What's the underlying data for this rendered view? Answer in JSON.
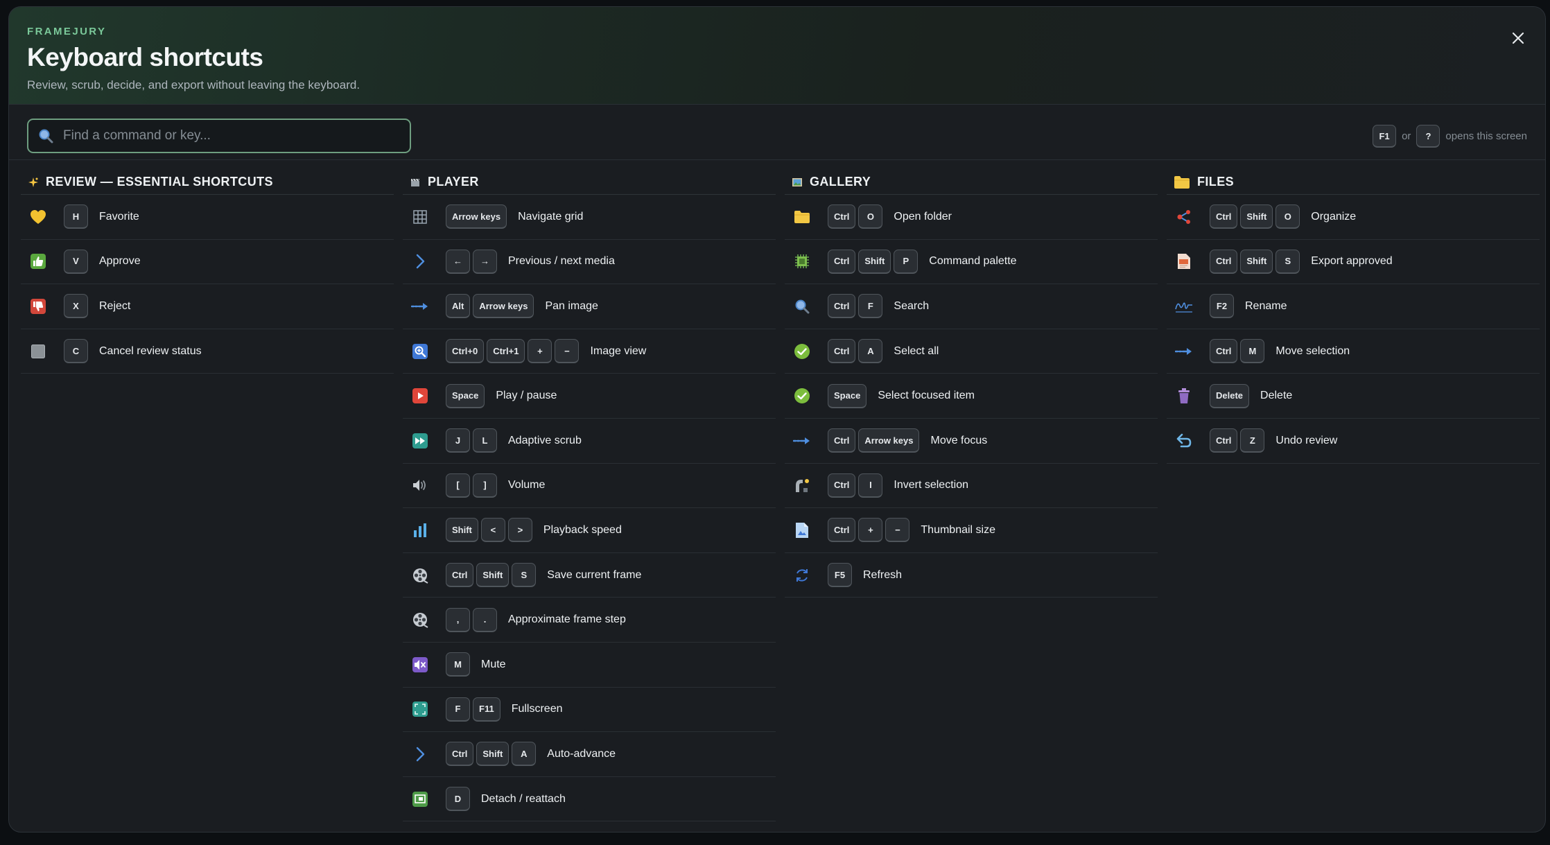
{
  "header": {
    "brand": "FRAMEJURY",
    "title": "Keyboard shortcuts",
    "subtitle": "Review, scrub, decide, and export without leaving the keyboard."
  },
  "search": {
    "placeholder": "Find a command or key..."
  },
  "hint": {
    "key1": "F1",
    "or": "or",
    "key2": "?",
    "text": "opens this screen"
  },
  "columns": [
    {
      "title": "REVIEW — ESSENTIAL SHORTCUTS",
      "icon": "sparkle-icon",
      "rows": [
        {
          "icon": "heart-icon",
          "keys": [
            "H"
          ],
          "label": "Favorite"
        },
        {
          "icon": "thumbs-up-icon",
          "keys": [
            "V"
          ],
          "label": "Approve"
        },
        {
          "icon": "thumbs-down-icon",
          "keys": [
            "X"
          ],
          "label": "Reject"
        },
        {
          "icon": "square-icon",
          "keys": [
            "C"
          ],
          "label": "Cancel review status"
        }
      ]
    },
    {
      "title": "PLAYER",
      "icon": "clapper-icon",
      "rows": [
        {
          "icon": "grid-icon",
          "keys": [
            "Arrow keys"
          ],
          "label": "Navigate grid"
        },
        {
          "icon": "chevron-right-icon",
          "keys": [
            "←",
            "→"
          ],
          "label": "Previous / next media"
        },
        {
          "icon": "arrow-right-icon",
          "keys": [
            "Alt",
            "Arrow keys"
          ],
          "label": "Pan image"
        },
        {
          "icon": "zoom-icon",
          "keys": [
            "Ctrl+0",
            "Ctrl+1",
            "+",
            "−"
          ],
          "label": "Image view"
        },
        {
          "icon": "play-icon",
          "keys": [
            "Space"
          ],
          "label": "Play / pause"
        },
        {
          "icon": "fast-forward-icon",
          "keys": [
            "J",
            "L"
          ],
          "label": "Adaptive scrub"
        },
        {
          "icon": "speaker-icon",
          "keys": [
            "[",
            "]"
          ],
          "label": "Volume"
        },
        {
          "icon": "bar-chart-icon",
          "keys": [
            "Shift",
            "<",
            ">"
          ],
          "label": "Playback speed"
        },
        {
          "icon": "film-reel-icon",
          "keys": [
            "Ctrl",
            "Shift",
            "S"
          ],
          "label": "Save current frame"
        },
        {
          "icon": "film-reel-icon",
          "keys": [
            ",",
            "."
          ],
          "label": "Approximate frame step"
        },
        {
          "icon": "mute-icon",
          "keys": [
            "M"
          ],
          "label": "Mute"
        },
        {
          "icon": "fullscreen-icon",
          "keys": [
            "F",
            "F11"
          ],
          "label": "Fullscreen"
        },
        {
          "icon": "chevron-right-icon",
          "keys": [
            "Ctrl",
            "Shift",
            "A"
          ],
          "label": "Auto-advance"
        },
        {
          "icon": "detach-icon",
          "keys": [
            "D"
          ],
          "label": "Detach / reattach"
        }
      ]
    },
    {
      "title": "GALLERY",
      "icon": "picture-icon",
      "rows": [
        {
          "icon": "folder-icon",
          "keys": [
            "Ctrl",
            "O"
          ],
          "label": "Open folder"
        },
        {
          "icon": "chip-icon",
          "keys": [
            "Ctrl",
            "Shift",
            "P"
          ],
          "label": "Command palette"
        },
        {
          "icon": "search-icon",
          "keys": [
            "Ctrl",
            "F"
          ],
          "label": "Search"
        },
        {
          "icon": "check-circle-icon",
          "keys": [
            "Ctrl",
            "A"
          ],
          "label": "Select all"
        },
        {
          "icon": "check-circle-icon",
          "keys": [
            "Space"
          ],
          "label": "Select focused item"
        },
        {
          "icon": "arrow-right-icon",
          "keys": [
            "Ctrl",
            "Arrow keys"
          ],
          "label": "Move focus"
        },
        {
          "icon": "invert-icon",
          "keys": [
            "Ctrl",
            "I"
          ],
          "label": "Invert selection"
        },
        {
          "icon": "image-file-icon",
          "keys": [
            "Ctrl",
            "+",
            "−"
          ],
          "label": "Thumbnail size"
        },
        {
          "icon": "refresh-icon",
          "keys": [
            "F5"
          ],
          "label": "Refresh"
        }
      ]
    },
    {
      "title": "FILES",
      "icon": "folder-icon",
      "rows": [
        {
          "icon": "share-icon",
          "keys": [
            "Ctrl",
            "Shift",
            "O"
          ],
          "label": "Organize"
        },
        {
          "icon": "export-file-icon",
          "keys": [
            "Ctrl",
            "Shift",
            "S"
          ],
          "label": "Export approved"
        },
        {
          "icon": "signature-icon",
          "keys": [
            "F2"
          ],
          "label": "Rename"
        },
        {
          "icon": "arrow-right-icon",
          "keys": [
            "Ctrl",
            "M"
          ],
          "label": "Move selection"
        },
        {
          "icon": "trash-icon",
          "keys": [
            "Delete"
          ],
          "label": "Delete"
        },
        {
          "icon": "undo-icon",
          "keys": [
            "Ctrl",
            "Z"
          ],
          "label": "Undo review"
        }
      ]
    }
  ],
  "colors": {
    "accent": "#7bc99a",
    "search_border": "#6e9e80",
    "background": "#1a1d21",
    "key_bg": "#2a2e33"
  }
}
